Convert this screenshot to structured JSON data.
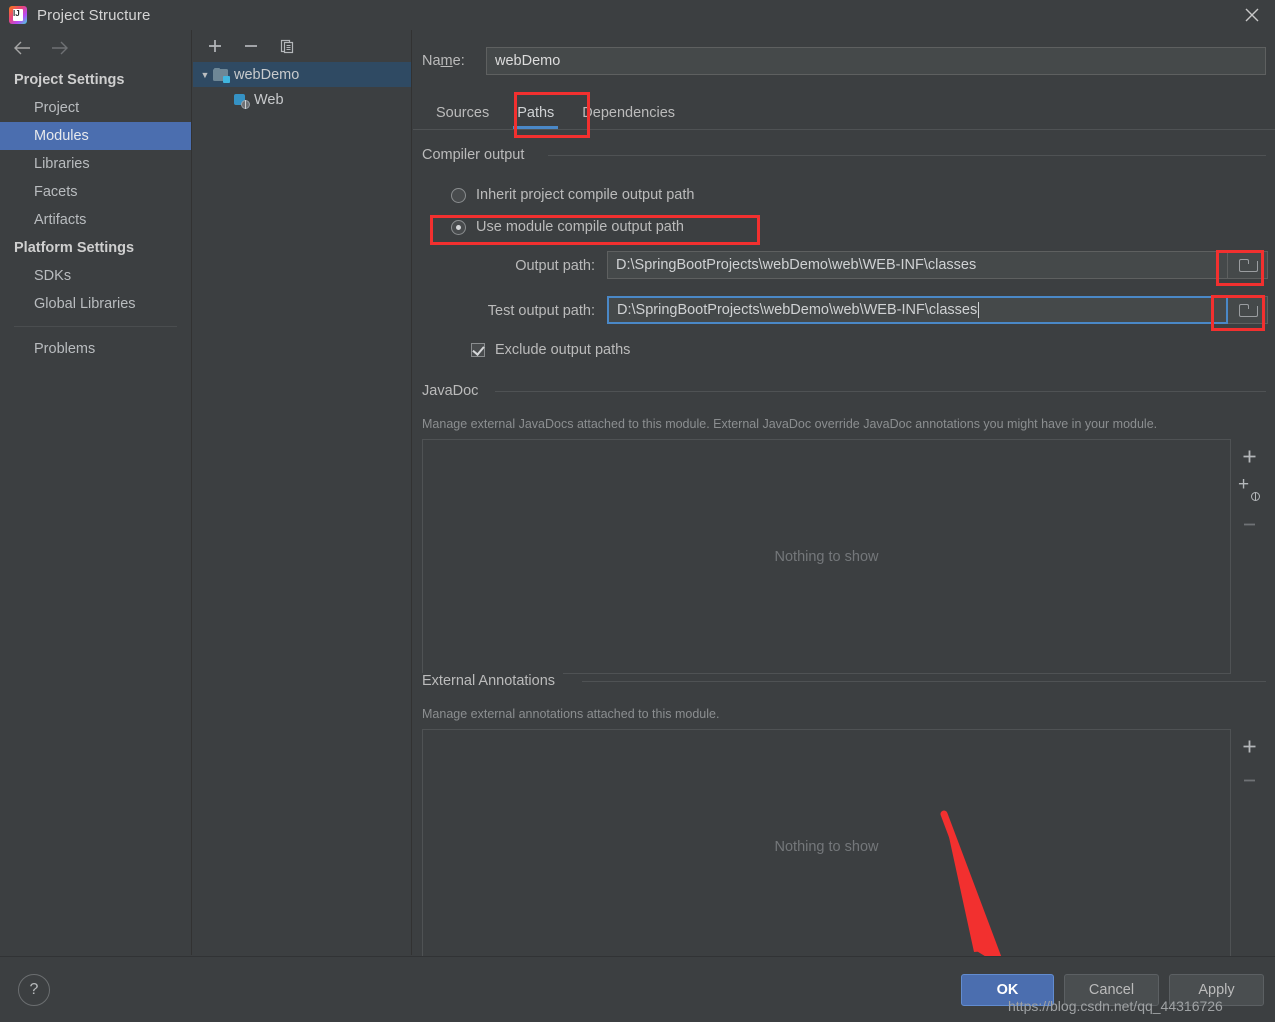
{
  "window": {
    "title": "Project Structure",
    "app_icon": "intellij-idea-icon",
    "close_icon": "close-icon"
  },
  "nav": {
    "back_icon": "arrow-left-icon",
    "forward_icon": "arrow-right-icon"
  },
  "sidebar": {
    "groups": [
      {
        "label": "Project Settings",
        "items": [
          {
            "label": "Project",
            "selected": false
          },
          {
            "label": "Modules",
            "selected": true
          },
          {
            "label": "Libraries",
            "selected": false
          },
          {
            "label": "Facets",
            "selected": false
          },
          {
            "label": "Artifacts",
            "selected": false
          }
        ]
      },
      {
        "label": "Platform Settings",
        "items": [
          {
            "label": "SDKs",
            "selected": false
          },
          {
            "label": "Global Libraries",
            "selected": false
          }
        ]
      }
    ],
    "problems_label": "Problems"
  },
  "tree": {
    "toolbar": {
      "add_icon": "plus-icon",
      "remove_icon": "minus-icon",
      "copy_icon": "copy-icon"
    },
    "nodes": [
      {
        "label": "webDemo",
        "icon": "module-folder-icon",
        "selected": true,
        "expanded": true
      },
      {
        "label": "Web",
        "icon": "web-facet-icon",
        "selected": false
      }
    ]
  },
  "main": {
    "name": {
      "label_pre": "Na",
      "label_mnemonic": "m",
      "label_post": "e:",
      "value": "webDemo"
    },
    "tabs": [
      {
        "label": "Sources",
        "active": false
      },
      {
        "label": "Paths",
        "active": true
      },
      {
        "label": "Dependencies",
        "active": false
      }
    ],
    "compiler_output": {
      "title": "Compiler output",
      "options": [
        {
          "label": "Inherit project compile output path",
          "checked": false
        },
        {
          "label": "Use module compile output path",
          "checked": true
        }
      ],
      "output_path": {
        "label": "Output path:",
        "value": "D:\\SpringBootProjects\\webDemo\\web\\WEB-INF\\classes",
        "focused": false,
        "browse_icon": "folder-browse-icon"
      },
      "test_output_path": {
        "label": "Test output path:",
        "value": "D:\\SpringBootProjects\\webDemo\\web\\WEB-INF\\classes",
        "focused": true,
        "browse_icon": "folder-browse-icon"
      },
      "exclude": {
        "label": "Exclude output paths",
        "checked": true
      }
    },
    "javadoc": {
      "title": "JavaDoc",
      "hint": "Manage external JavaDocs attached to this module. External JavaDoc override JavaDoc annotations you might have in your module.",
      "empty": "Nothing to show",
      "buttons": [
        {
          "icon": "plus-icon",
          "enabled": true
        },
        {
          "icon": "plus-url-globe-icon",
          "enabled": true
        },
        {
          "icon": "minus-icon",
          "enabled": false
        }
      ]
    },
    "external_annotations": {
      "title": "External Annotations",
      "hint": "Manage external annotations attached to this module.",
      "empty": "Nothing to show",
      "buttons": [
        {
          "icon": "plus-icon",
          "enabled": true
        },
        {
          "icon": "minus-icon",
          "enabled": false
        }
      ]
    }
  },
  "footer": {
    "help_label": "?",
    "ok_label": "OK",
    "cancel_label": "Cancel",
    "apply_label": "Apply"
  },
  "watermark": "https://blog.csdn.net/qq_44316726",
  "colors": {
    "accent_blue": "#4b6eaf",
    "tab_underline": "#4a88c7",
    "focus_border": "#4a88c7",
    "annotation_red": "#f2302f",
    "window_bg": "#3c3f41",
    "tree_selected": "#2f4a63"
  }
}
